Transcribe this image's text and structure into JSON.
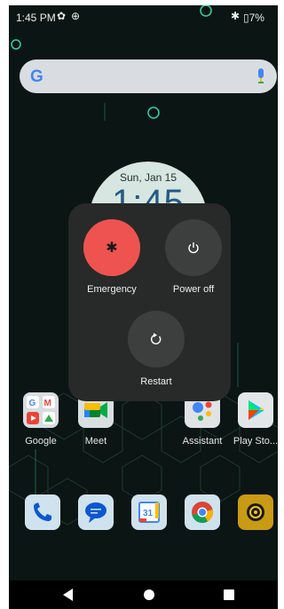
{
  "status": {
    "time": "1:45 PM",
    "battery": "7%"
  },
  "search": {},
  "clock": {
    "date": "Sun, Jan 15",
    "time": "1:45"
  },
  "power_menu": {
    "emergency_label": "Emergency",
    "power_off_label": "Power off",
    "restart_label": "Restart"
  },
  "apps": [
    {
      "label": "Google"
    },
    {
      "label": "Meet"
    },
    {
      "label": "Assistant"
    },
    {
      "label": "Play Sto..."
    }
  ],
  "dock": [
    {
      "icon": "phone-icon"
    },
    {
      "icon": "messages-icon"
    },
    {
      "icon": "calendar-icon",
      "text": "31"
    },
    {
      "icon": "chrome-icon"
    },
    {
      "icon": "camera-icon"
    }
  ],
  "colors": {
    "emergency": "#ef5350",
    "dialog": "#272a29",
    "button": "#3c3f3d",
    "wallpaper": "#0b1513"
  }
}
